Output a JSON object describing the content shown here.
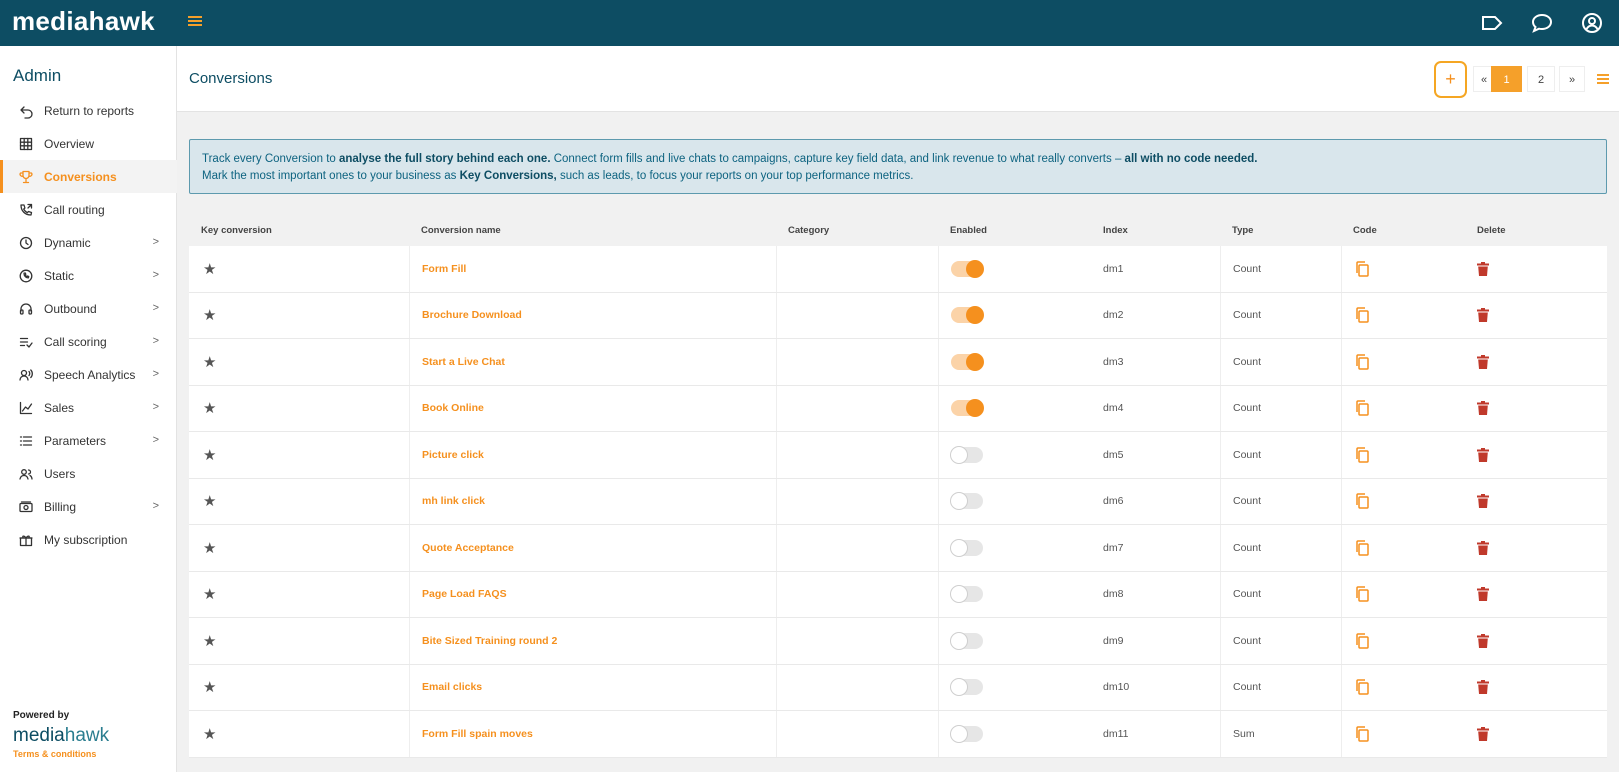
{
  "app": {
    "logo": "mediahawk"
  },
  "sidebar": {
    "title": "Admin",
    "items": [
      {
        "label": "Return to reports",
        "icon": "return-icon",
        "chevron": false,
        "active": false
      },
      {
        "label": "Overview",
        "icon": "grid-icon",
        "chevron": false,
        "active": false
      },
      {
        "label": "Conversions",
        "icon": "trophy-icon",
        "chevron": false,
        "active": true
      },
      {
        "label": "Call routing",
        "icon": "phone-routing-icon",
        "chevron": false,
        "active": false
      },
      {
        "label": "Dynamic",
        "icon": "dynamic-icon",
        "chevron": true,
        "active": false
      },
      {
        "label": "Static",
        "icon": "phone-icon",
        "chevron": true,
        "active": false
      },
      {
        "label": "Outbound",
        "icon": "headset-icon",
        "chevron": true,
        "active": false
      },
      {
        "label": "Call scoring",
        "icon": "scoring-icon",
        "chevron": true,
        "active": false
      },
      {
        "label": "Speech Analytics",
        "icon": "speech-icon",
        "chevron": true,
        "active": false
      },
      {
        "label": "Sales",
        "icon": "chart-icon",
        "chevron": true,
        "active": false
      },
      {
        "label": "Parameters",
        "icon": "list-icon",
        "chevron": true,
        "active": false
      },
      {
        "label": "Users",
        "icon": "users-icon",
        "chevron": false,
        "active": false
      },
      {
        "label": "Billing",
        "icon": "billing-icon",
        "chevron": true,
        "active": false
      },
      {
        "label": "My subscription",
        "icon": "gift-icon",
        "chevron": false,
        "active": false
      }
    ],
    "chevron_glyph": ">",
    "powered_by": "Powered by",
    "footer_logo_a": "media",
    "footer_logo_b": "hawk",
    "terms": "Terms & conditions"
  },
  "header": {
    "title": "Conversions",
    "add_label": "+",
    "pager": {
      "prev": "«",
      "page1": "1",
      "page2": "2",
      "next": "»"
    }
  },
  "info": {
    "line1_a": "Track every Conversion to ",
    "line1_b": "analyse the full story behind each one.",
    "line1_c": " Connect form fills and live chats to campaigns, capture key field data, and link revenue to what really converts – ",
    "line1_d": "all with no code needed.",
    "line2_a": "Mark the most important ones to your business as ",
    "line2_b": "Key Conversions,",
    "line2_c": " such as leads, to focus your reports on your top performance metrics."
  },
  "table": {
    "columns": [
      "Key conversion",
      "Conversion name",
      "Category",
      "Enabled",
      "Index",
      "Type",
      "Code",
      "Delete"
    ],
    "rows": [
      {
        "name": "Form Fill",
        "category": "",
        "enabled": true,
        "index": "dm1",
        "type": "Count"
      },
      {
        "name": "Brochure Download",
        "category": "",
        "enabled": true,
        "index": "dm2",
        "type": "Count"
      },
      {
        "name": "Start a Live Chat",
        "category": "",
        "enabled": true,
        "index": "dm3",
        "type": "Count"
      },
      {
        "name": "Book Online",
        "category": "",
        "enabled": true,
        "index": "dm4",
        "type": "Count"
      },
      {
        "name": "Picture click",
        "category": "",
        "enabled": false,
        "index": "dm5",
        "type": "Count"
      },
      {
        "name": "mh link click",
        "category": "",
        "enabled": false,
        "index": "dm6",
        "type": "Count"
      },
      {
        "name": "Quote Acceptance",
        "category": "",
        "enabled": false,
        "index": "dm7",
        "type": "Count"
      },
      {
        "name": "Page Load FAQS",
        "category": "",
        "enabled": false,
        "index": "dm8",
        "type": "Count"
      },
      {
        "name": "Bite Sized Training round 2",
        "category": "",
        "enabled": false,
        "index": "dm9",
        "type": "Count"
      },
      {
        "name": "Email clicks",
        "category": "",
        "enabled": false,
        "index": "dm10",
        "type": "Count"
      },
      {
        "name": "Form Fill spain moves",
        "category": "",
        "enabled": false,
        "index": "dm11",
        "type": "Sum"
      }
    ]
  },
  "colors": {
    "brand": "#0d4d63",
    "accent": "#f5901e",
    "delete": "#c0392b"
  }
}
